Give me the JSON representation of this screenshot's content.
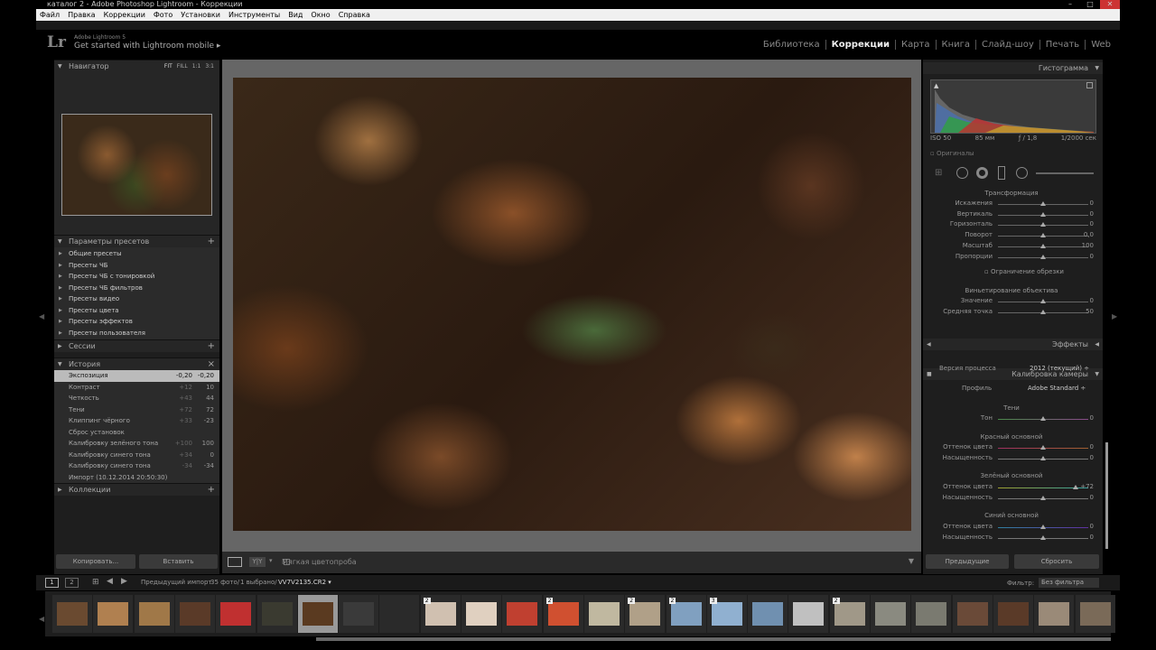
{
  "window": {
    "title": "каталог 2 - Adobe Photoshop Lightroom - Коррекции"
  },
  "menu": [
    "Файл",
    "Правка",
    "Коррекции",
    "Фото",
    "Установки",
    "Инструменты",
    "Вид",
    "Окно",
    "Справка"
  ],
  "identity": {
    "logo": "Lr",
    "version": "Adobe Lightroom 5",
    "mobile": "Get started with Lightroom mobile  ▸"
  },
  "modules": [
    "Библиотека",
    "Коррекции",
    "Карта",
    "Книга",
    "Слайд-шоу",
    "Печать",
    "Web"
  ],
  "active_module": "Коррекции",
  "navigator": {
    "title": "Навигатор",
    "zoom": [
      "FIT",
      "FILL",
      "1:1",
      "3:1"
    ]
  },
  "presets": {
    "title": "Параметры пресетов",
    "items": [
      "Общие пресеты",
      "Пресеты ЧБ",
      "Пресеты ЧБ с тонировкой",
      "Пресеты ЧБ фильтров",
      "Пресеты видео",
      "Пресеты цвета",
      "Пресеты эффектов",
      "Пресеты пользователя"
    ]
  },
  "sessions": {
    "title": "Сессии"
  },
  "history": {
    "title": "История",
    "items": [
      {
        "label": "Экспозиция",
        "v1": "-0,20",
        "v2": "-0,20"
      },
      {
        "label": "Контраст",
        "v1": "+12",
        "v2": "10"
      },
      {
        "label": "Четкость",
        "v1": "+43",
        "v2": "44"
      },
      {
        "label": "Тени",
        "v1": "+72",
        "v2": "72"
      },
      {
        "label": "Клиппинг чёрного",
        "v1": "+33",
        "v2": "-23"
      },
      {
        "label": "Сброс установок",
        "v1": "",
        "v2": ""
      },
      {
        "label": "Калибровку зелёного тона",
        "v1": "+100",
        "v2": "100"
      },
      {
        "label": "Калибровку синего тона",
        "v1": "+34",
        "v2": "0"
      },
      {
        "label": "Калибровку синего тона",
        "v1": "-34",
        "v2": "-34"
      },
      {
        "label": "Импорт (10.12.2014 20:50:30)",
        "v1": "",
        "v2": ""
      }
    ]
  },
  "collections": {
    "title": "Коллекции"
  },
  "left_buttons": {
    "copy": "Копировать...",
    "paste": "Вставить"
  },
  "toolbar": {
    "softproof": "Мягкая цветопроба"
  },
  "histogram": {
    "title": "Гистограмма",
    "iso": "ISO 50",
    "focal": "85 мм",
    "aperture": "ƒ / 1,8",
    "shutter": "1/2000 сек",
    "original": "Оригиналы"
  },
  "transform": {
    "title": "Трансформация",
    "rows": [
      {
        "label": "Искажения",
        "value": "0",
        "pos": 0.5
      },
      {
        "label": "Вертикаль",
        "value": "0",
        "pos": 0.5
      },
      {
        "label": "Горизонталь",
        "value": "0",
        "pos": 0.5
      },
      {
        "label": "Поворот",
        "value": "0,0",
        "pos": 0.5
      },
      {
        "label": "Масштаб",
        "value": "100",
        "pos": 0.5
      },
      {
        "label": "Пропорции",
        "value": "0",
        "pos": 0.5
      }
    ],
    "constrain": "Ограничение обрезки"
  },
  "vignette": {
    "title": "Виньетирование объектива",
    "rows": [
      {
        "label": "Значение",
        "value": "0",
        "pos": 0.5
      },
      {
        "label": "Средняя точка",
        "value": "50",
        "pos": 0.5
      }
    ]
  },
  "effects": {
    "title": "Эффекты"
  },
  "calibration": {
    "title": "Калибровка камеры",
    "process_label": "Версия процесса",
    "process_value": "2012 (текущий) ÷",
    "profile_label": "Профиль",
    "profile_value": "Adobe Standard ÷",
    "shadows_title": "Тени",
    "shadows": [
      {
        "label": "Тон",
        "value": "0",
        "pos": 0.5
      }
    ],
    "red_title": "Красный основной",
    "red": [
      {
        "label": "Оттенок цвета",
        "value": "0",
        "pos": 0.5
      },
      {
        "label": "Насыщенность",
        "value": "0",
        "pos": 0.5
      }
    ],
    "green_title": "Зелёный основной",
    "green": [
      {
        "label": "Оттенок цвета",
        "value": "+72",
        "pos": 0.86
      },
      {
        "label": "Насыщенность",
        "value": "0",
        "pos": 0.5
      }
    ],
    "blue_title": "Синий основной",
    "blue": [
      {
        "label": "Оттенок цвета",
        "value": "0",
        "pos": 0.5
      },
      {
        "label": "Насыщенность",
        "value": "0",
        "pos": 0.5
      }
    ]
  },
  "right_buttons": {
    "previous": "Предыдущие",
    "reset": "Сбросить"
  },
  "filmbar": {
    "pages": [
      "1",
      "2"
    ],
    "source": "Предыдущий импорт",
    "count": "35 фото/",
    "selected": "1 выбрано/",
    "file": "VV7V2135.CR2 ▾",
    "filter_label": "Фильтр:",
    "filter_value": "Без фильтра"
  },
  "thumbs": [
    "#6a4a30",
    "#b08050",
    "#a07848",
    "#5a3a28",
    "#c03030",
    "#3a3a30",
    "#5a3a20",
    "#3a3a3a",
    "#2a2a2a",
    "#d0c0b0",
    "#e0d0c0",
    "#c04030",
    "#d05030",
    "#c0b8a0",
    "#b0a088",
    "#80a0c0",
    "#90b0d0",
    "#7090b0",
    "#c0c0c0",
    "#a09888",
    "#8a8a80",
    "#7a7a70",
    "#6a4a38",
    "#5a3a28",
    "#9a8a78",
    "#7a6a58"
  ],
  "thumb_badges": [
    "",
    "",
    "",
    "",
    "",
    "",
    "",
    "",
    "",
    "2",
    "",
    "",
    "2",
    "",
    "2",
    "2",
    "3",
    "",
    "",
    "2",
    "",
    "",
    "",
    "",
    "",
    ""
  ]
}
